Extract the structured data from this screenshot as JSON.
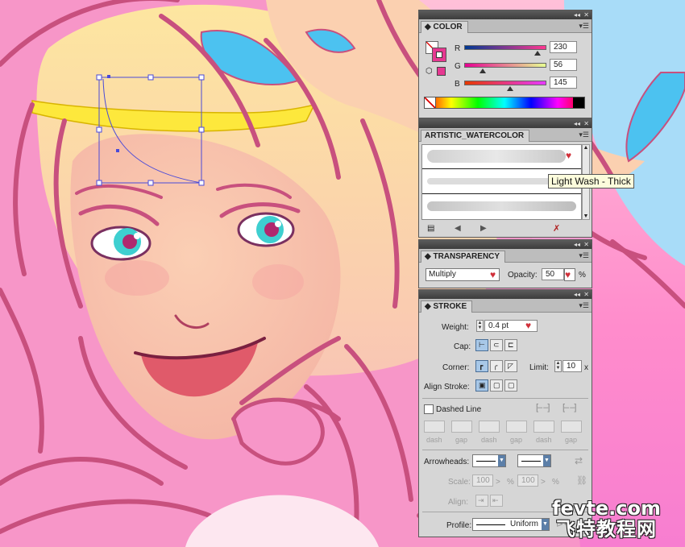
{
  "color_panel": {
    "title": "COLOR",
    "r_label": "R",
    "r_value": "230",
    "g_label": "G",
    "g_value": "56",
    "b_label": "B",
    "b_value": "145",
    "fill_hex": "#e63891"
  },
  "brush_panel": {
    "title": "ARTISTIC_WATERCOLOR",
    "tooltip": "Light Wash - Thick"
  },
  "transparency_panel": {
    "title": "TRANSPARENCY",
    "blend_mode": "Multiply",
    "opacity_label": "Opacity:",
    "opacity_value": "50",
    "percent": "%"
  },
  "stroke_panel": {
    "title": "STROKE",
    "weight_label": "Weight:",
    "weight_value": "0.4 pt",
    "cap_label": "Cap:",
    "corner_label": "Corner:",
    "limit_label": "Limit:",
    "limit_value": "10",
    "limit_unit": "x",
    "align_label": "Align Stroke:",
    "dashed_label": "Dashed Line",
    "dash_labels": [
      "dash",
      "gap",
      "dash",
      "gap",
      "dash",
      "gap"
    ],
    "arrowheads_label": "Arrowheads:",
    "scale_label": "Scale:",
    "scale_1": "100",
    "scale_2": "100",
    "percent": "%",
    "align_label2": "Align:",
    "profile_label": "Profile:",
    "profile_value": "Uniform"
  },
  "watermark": {
    "line1": "fevte.com",
    "line2": "飞特教程网"
  },
  "colors": {
    "selection": "#4a4ad8",
    "hair_outline": "#c8507e",
    "pink_hair": "#f59ac6",
    "blonde_hair": "#fbd8a8",
    "tiara": "#fde83c",
    "bow": "#4cc2f0"
  }
}
